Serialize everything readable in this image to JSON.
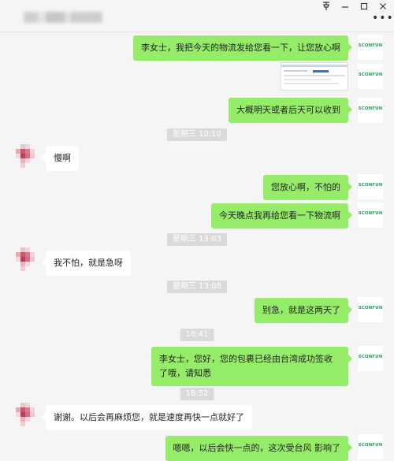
{
  "window": {
    "pin_icon": "pin-icon",
    "minimize_icon": "minimize-icon",
    "maximize_icon": "maximize-icon",
    "close_icon": "close-icon",
    "more_icon": "more-icon"
  },
  "brand_avatar_text": "SCONFUN",
  "messages": [
    {
      "type": "sent",
      "text": "李女士，我把今天的物流发给您看一下，让您放心啊"
    },
    {
      "type": "sent_image"
    },
    {
      "type": "sent",
      "text": "大概明天或者后天可以收到"
    },
    {
      "type": "time",
      "text": "星期三 10:10"
    },
    {
      "type": "received",
      "text": "慢啊"
    },
    {
      "type": "sent",
      "text": "您放心啊，不怕的"
    },
    {
      "type": "sent",
      "text": "今天晚点我再给您看一下物流啊"
    },
    {
      "type": "time",
      "text": "星期三 13:03"
    },
    {
      "type": "received",
      "text": "我不怕，就是急呀"
    },
    {
      "type": "time",
      "text": "星期三 13:08"
    },
    {
      "type": "sent",
      "text": "别急，就是这两天了"
    },
    {
      "type": "time",
      "text": "18:41"
    },
    {
      "type": "sent",
      "text": "李女士，您好，您的包裹已经由台湾成功签收了哦，请知悉"
    },
    {
      "type": "time",
      "text": "18:52"
    },
    {
      "type": "received",
      "text": "谢谢。以后会再麻烦您，就是速度再快一点就好了"
    },
    {
      "type": "sent",
      "text": "嗯嗯，以后会快一点的，这次受台风 影响了"
    }
  ]
}
